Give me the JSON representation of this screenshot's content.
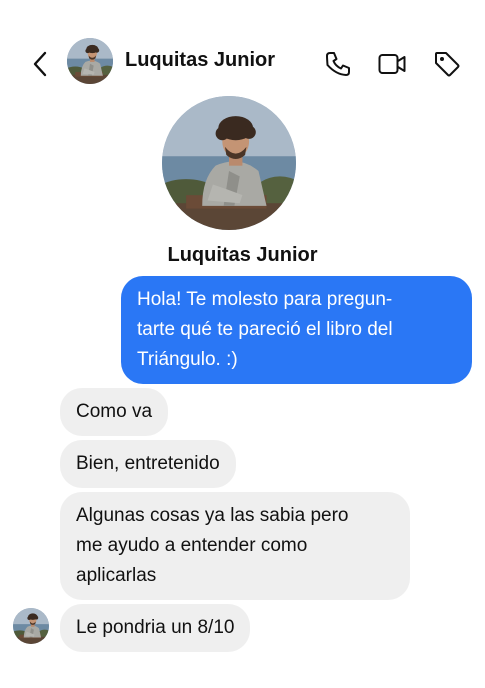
{
  "header": {
    "contact_name": "Luquitas Junior",
    "back_icon": "chevron-left-icon",
    "call_icon": "phone-icon",
    "video_icon": "video-camera-icon",
    "tag_icon": "tag-icon"
  },
  "profile": {
    "name": "Luquitas Junior"
  },
  "messages": [
    {
      "direction": "outgoing",
      "text": "Hola! Te molesto para pregun-\ntarte qué te pareció el libro del\nTriángulo. :)"
    },
    {
      "direction": "incoming",
      "text": "Como va"
    },
    {
      "direction": "incoming",
      "text": "Bien, entretenido"
    },
    {
      "direction": "incoming",
      "text": "Algunas cosas ya las sabia pero\nme ayudo a entender como\naplicarlas"
    },
    {
      "direction": "incoming",
      "text": "Le pondria un 8/10"
    }
  ],
  "colors": {
    "outgoing_bubble": "#2a77f5",
    "incoming_bubble": "#efefef",
    "text": "#111111"
  }
}
